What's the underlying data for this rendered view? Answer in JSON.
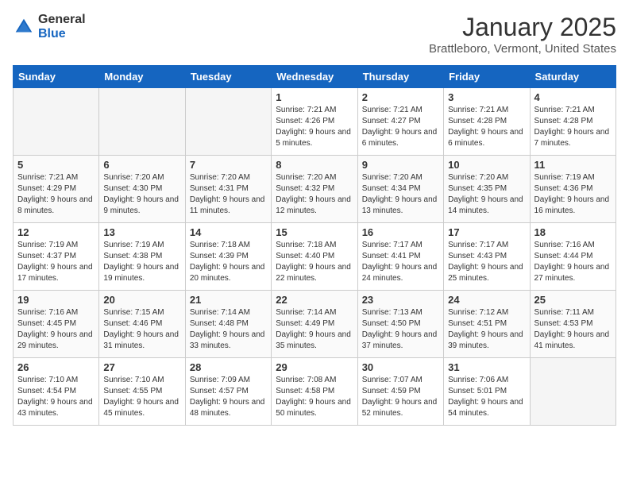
{
  "header": {
    "logo_general": "General",
    "logo_blue": "Blue",
    "title": "January 2025",
    "location": "Brattleboro, Vermont, United States"
  },
  "days_of_week": [
    "Sunday",
    "Monday",
    "Tuesday",
    "Wednesday",
    "Thursday",
    "Friday",
    "Saturday"
  ],
  "weeks": [
    [
      {
        "day": "",
        "empty": true
      },
      {
        "day": "",
        "empty": true
      },
      {
        "day": "",
        "empty": true
      },
      {
        "day": "1",
        "sunrise": "7:21 AM",
        "sunset": "4:26 PM",
        "daylight": "9 hours and 5 minutes."
      },
      {
        "day": "2",
        "sunrise": "7:21 AM",
        "sunset": "4:27 PM",
        "daylight": "9 hours and 6 minutes."
      },
      {
        "day": "3",
        "sunrise": "7:21 AM",
        "sunset": "4:28 PM",
        "daylight": "9 hours and 6 minutes."
      },
      {
        "day": "4",
        "sunrise": "7:21 AM",
        "sunset": "4:28 PM",
        "daylight": "9 hours and 7 minutes."
      }
    ],
    [
      {
        "day": "5",
        "sunrise": "7:21 AM",
        "sunset": "4:29 PM",
        "daylight": "9 hours and 8 minutes."
      },
      {
        "day": "6",
        "sunrise": "7:20 AM",
        "sunset": "4:30 PM",
        "daylight": "9 hours and 9 minutes."
      },
      {
        "day": "7",
        "sunrise": "7:20 AM",
        "sunset": "4:31 PM",
        "daylight": "9 hours and 11 minutes."
      },
      {
        "day": "8",
        "sunrise": "7:20 AM",
        "sunset": "4:32 PM",
        "daylight": "9 hours and 12 minutes."
      },
      {
        "day": "9",
        "sunrise": "7:20 AM",
        "sunset": "4:34 PM",
        "daylight": "9 hours and 13 minutes."
      },
      {
        "day": "10",
        "sunrise": "7:20 AM",
        "sunset": "4:35 PM",
        "daylight": "9 hours and 14 minutes."
      },
      {
        "day": "11",
        "sunrise": "7:19 AM",
        "sunset": "4:36 PM",
        "daylight": "9 hours and 16 minutes."
      }
    ],
    [
      {
        "day": "12",
        "sunrise": "7:19 AM",
        "sunset": "4:37 PM",
        "daylight": "9 hours and 17 minutes."
      },
      {
        "day": "13",
        "sunrise": "7:19 AM",
        "sunset": "4:38 PM",
        "daylight": "9 hours and 19 minutes."
      },
      {
        "day": "14",
        "sunrise": "7:18 AM",
        "sunset": "4:39 PM",
        "daylight": "9 hours and 20 minutes."
      },
      {
        "day": "15",
        "sunrise": "7:18 AM",
        "sunset": "4:40 PM",
        "daylight": "9 hours and 22 minutes."
      },
      {
        "day": "16",
        "sunrise": "7:17 AM",
        "sunset": "4:41 PM",
        "daylight": "9 hours and 24 minutes."
      },
      {
        "day": "17",
        "sunrise": "7:17 AM",
        "sunset": "4:43 PM",
        "daylight": "9 hours and 25 minutes."
      },
      {
        "day": "18",
        "sunrise": "7:16 AM",
        "sunset": "4:44 PM",
        "daylight": "9 hours and 27 minutes."
      }
    ],
    [
      {
        "day": "19",
        "sunrise": "7:16 AM",
        "sunset": "4:45 PM",
        "daylight": "9 hours and 29 minutes."
      },
      {
        "day": "20",
        "sunrise": "7:15 AM",
        "sunset": "4:46 PM",
        "daylight": "9 hours and 31 minutes."
      },
      {
        "day": "21",
        "sunrise": "7:14 AM",
        "sunset": "4:48 PM",
        "daylight": "9 hours and 33 minutes."
      },
      {
        "day": "22",
        "sunrise": "7:14 AM",
        "sunset": "4:49 PM",
        "daylight": "9 hours and 35 minutes."
      },
      {
        "day": "23",
        "sunrise": "7:13 AM",
        "sunset": "4:50 PM",
        "daylight": "9 hours and 37 minutes."
      },
      {
        "day": "24",
        "sunrise": "7:12 AM",
        "sunset": "4:51 PM",
        "daylight": "9 hours and 39 minutes."
      },
      {
        "day": "25",
        "sunrise": "7:11 AM",
        "sunset": "4:53 PM",
        "daylight": "9 hours and 41 minutes."
      }
    ],
    [
      {
        "day": "26",
        "sunrise": "7:10 AM",
        "sunset": "4:54 PM",
        "daylight": "9 hours and 43 minutes."
      },
      {
        "day": "27",
        "sunrise": "7:10 AM",
        "sunset": "4:55 PM",
        "daylight": "9 hours and 45 minutes."
      },
      {
        "day": "28",
        "sunrise": "7:09 AM",
        "sunset": "4:57 PM",
        "daylight": "9 hours and 48 minutes."
      },
      {
        "day": "29",
        "sunrise": "7:08 AM",
        "sunset": "4:58 PM",
        "daylight": "9 hours and 50 minutes."
      },
      {
        "day": "30",
        "sunrise": "7:07 AM",
        "sunset": "4:59 PM",
        "daylight": "9 hours and 52 minutes."
      },
      {
        "day": "31",
        "sunrise": "7:06 AM",
        "sunset": "5:01 PM",
        "daylight": "9 hours and 54 minutes."
      },
      {
        "day": "",
        "empty": true
      }
    ]
  ]
}
